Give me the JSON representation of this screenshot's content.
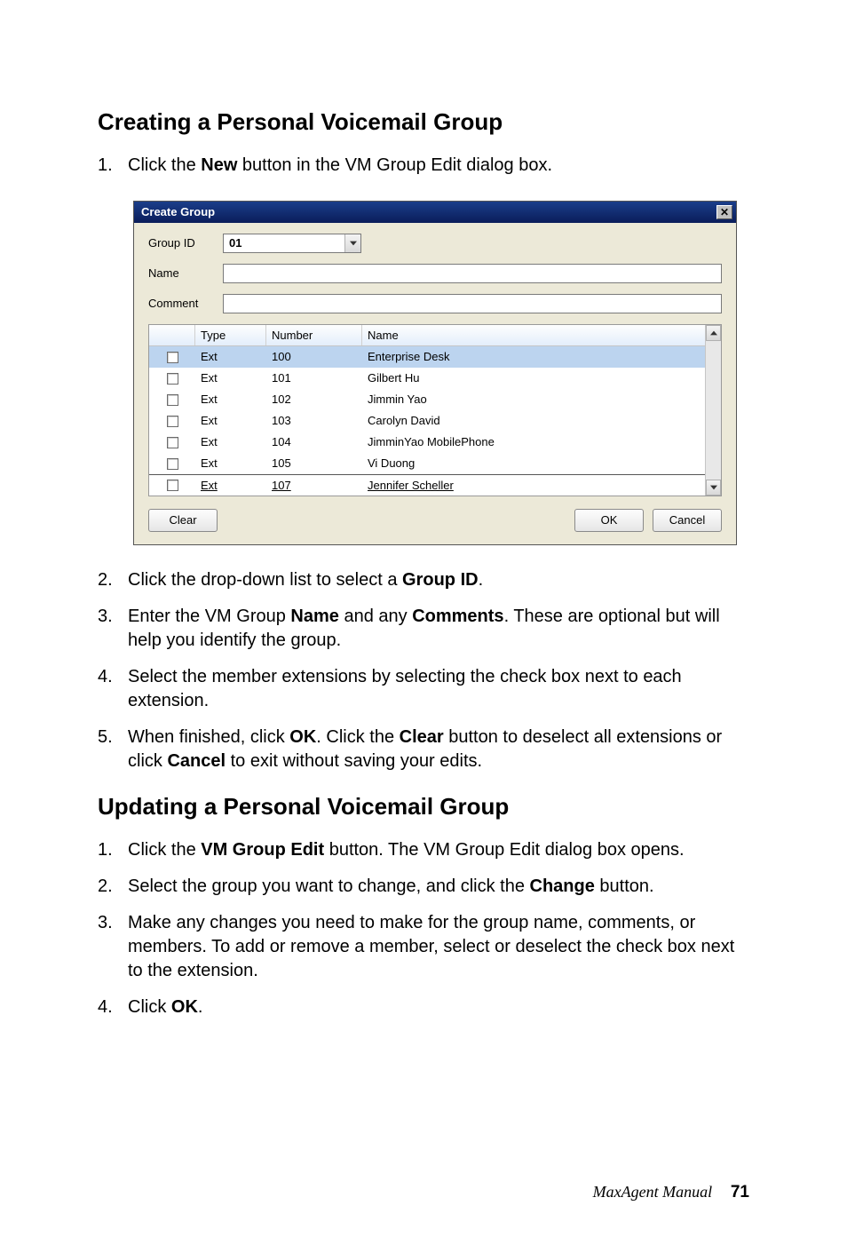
{
  "section1_title": "Creating a Personal Voicemail Group",
  "section2_title": "Updating a Personal Voicemail Group",
  "steps1": {
    "s1": {
      "num": "1.",
      "pre": "Click the ",
      "bold": "New",
      "post": " button in the VM Group Edit dialog box."
    },
    "s2": {
      "num": "2.",
      "pre": "Click the drop-down list to select a ",
      "bold": "Group ID",
      "post": "."
    },
    "s3": {
      "num": "3.",
      "pre": "Enter the VM Group ",
      "b1": "Name",
      "mid": " and any ",
      "b2": "Comments",
      "post": ". These are optional but will help you identify the group."
    },
    "s4": {
      "num": "4.",
      "text": "Select the member extensions by selecting the check box next to each extension."
    },
    "s5": {
      "num": "5.",
      "pre": "When finished, click ",
      "b1": "OK",
      "mid": ". Click the ",
      "b2": "Clear",
      "mid2": " button to deselect all extensions or click ",
      "b3": "Cancel",
      "post": " to exit without saving your edits."
    }
  },
  "steps2": {
    "s1": {
      "num": "1.",
      "pre": "Click the ",
      "bold": "VM Group Edit",
      "post": " button. The VM Group Edit dialog box opens."
    },
    "s2": {
      "num": "2.",
      "pre": "Select the group you want to change, and click the ",
      "bold": "Change",
      "post": " button."
    },
    "s3": {
      "num": "3.",
      "text": "Make any changes you need to make for the group name, comments, or members. To add or remove a member, select or deselect the check box next to the extension."
    },
    "s4": {
      "num": "4.",
      "pre": "Click ",
      "bold": "OK",
      "post": "."
    }
  },
  "dialog": {
    "title": "Create Group",
    "labels": {
      "group_id": "Group ID",
      "name": "Name",
      "comment": "Comment"
    },
    "group_id_value": "01",
    "headers": {
      "type": "Type",
      "number": "Number",
      "name": "Name"
    },
    "rows": [
      {
        "type": "Ext",
        "number": "100",
        "name": "Enterprise Desk",
        "selected": true
      },
      {
        "type": "Ext",
        "number": "101",
        "name": "Gilbert Hu"
      },
      {
        "type": "Ext",
        "number": "102",
        "name": "Jimmin Yao"
      },
      {
        "type": "Ext",
        "number": "103",
        "name": "Carolyn David"
      },
      {
        "type": "Ext",
        "number": "104",
        "name": "JimminYao MobilePhone"
      },
      {
        "type": "Ext",
        "number": "105",
        "name": "Vi Duong"
      },
      {
        "type": "Ext",
        "number": "107",
        "name": "Jennifer Scheller",
        "last": true
      }
    ],
    "buttons": {
      "clear": "Clear",
      "ok": "OK",
      "cancel": "Cancel"
    }
  },
  "footer": {
    "title": "MaxAgent Manual",
    "page": "71"
  }
}
